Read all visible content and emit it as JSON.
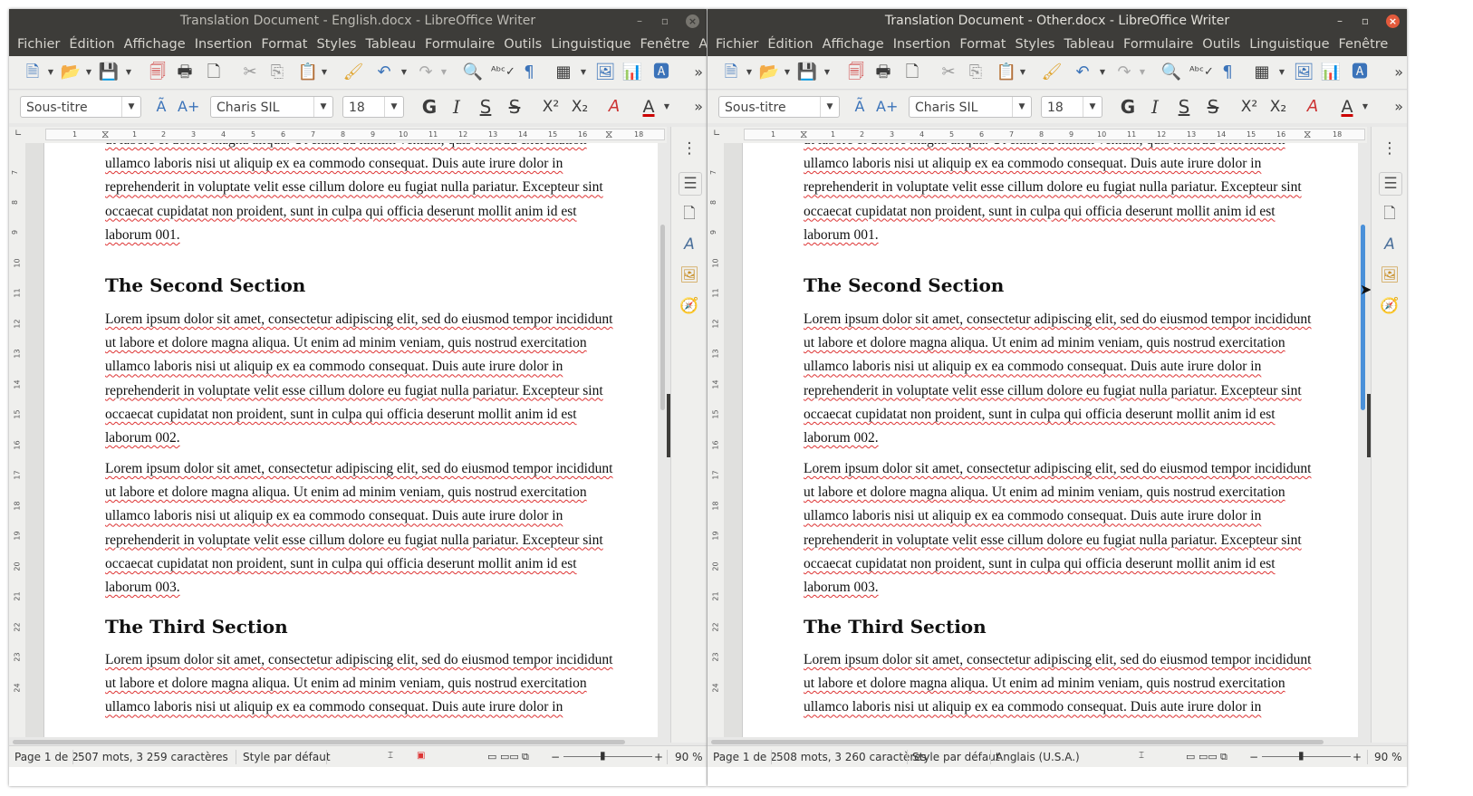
{
  "colors": {
    "titlebar": "#3d3c39",
    "accent": "#4a90d9",
    "spell_underline": "#dd3333",
    "font_color_red": "#cc0000"
  },
  "menu": [
    "Fichier",
    "Édition",
    "Affichage",
    "Insertion",
    "Format",
    "Styles",
    "Tableau",
    "Formulaire",
    "Outils",
    "Linguistique",
    "Fenêtre",
    "A"
  ],
  "toolbar": {
    "style_value": "Sous-titre",
    "font_value": "Charis SIL",
    "size_value": "18"
  },
  "ruler_ticks": [
    "1",
    "1",
    "2",
    "3",
    "4",
    "5",
    "6",
    "7",
    "8",
    "9",
    "10",
    "11",
    "12",
    "13",
    "14",
    "15",
    "16",
    "17",
    "18"
  ],
  "vruler_ticks": [
    "7",
    "8",
    "9",
    "10",
    "11",
    "12",
    "13",
    "14",
    "15",
    "16",
    "17",
    "18",
    "19",
    "20",
    "21",
    "22",
    "23",
    "24"
  ],
  "icons": [
    "new-document-icon",
    "open-folder-icon",
    "save-icon",
    "export-pdf-icon",
    "print-icon",
    "print-preview-icon",
    "cut-icon",
    "copy-icon",
    "paste-icon",
    "clone-formatting-icon",
    "undo-icon",
    "redo-icon",
    "find-replace-icon",
    "spellcheck-icon",
    "formatting-marks-icon",
    "insert-table-icon",
    "insert-image-icon",
    "insert-chart-icon",
    "insert-textbox-icon"
  ],
  "doc": {
    "p_top": [
      "ut labore et dolore magna aliqua. Ut enim ad minim veniam, quis nostrud exercitation",
      "ullamco laboris nisi ut aliquip ex ea commodo consequat. Duis aute irure dolor in",
      "reprehenderit in voluptate velit esse cillum dolore eu fugiat nulla pariatur. Excepteur sint",
      "occaecat cupidatat non proident, sunt in culpa qui officia deserunt mollit anim id est",
      "laborum 001."
    ],
    "h2": "The Second Section",
    "p2": [
      "Lorem ipsum dolor sit amet, consectetur adipiscing elit, sed do eiusmod tempor incididunt",
      "ut labore et dolore magna aliqua. Ut enim ad minim veniam, quis nostrud exercitation",
      "ullamco laboris nisi ut aliquip ex ea commodo consequat. Duis aute irure dolor in",
      "reprehenderit in voluptate velit esse cillum dolore eu fugiat nulla pariatur. Excepteur sint",
      "occaecat cupidatat non proident, sunt in culpa qui officia deserunt mollit anim id est",
      "laborum 002."
    ],
    "p3": [
      "Lorem ipsum dolor sit amet, consectetur adipiscing elit, sed do eiusmod tempor incididunt",
      "ut labore et dolore magna aliqua. Ut enim ad minim veniam, quis nostrud exercitation",
      "ullamco laboris nisi ut aliquip ex ea commodo consequat. Duis aute irure dolor in",
      "reprehenderit in voluptate velit esse cillum dolore eu fugiat nulla pariatur. Excepteur sint",
      "occaecat cupidatat non proident, sunt in culpa qui officia deserunt mollit anim id est",
      "laborum 003."
    ],
    "h3": "The Third Section",
    "p4": [
      "Lorem ipsum dolor sit amet, consectetur adipiscing elit, sed do eiusmod tempor incididunt",
      "ut labore et dolore magna aliqua. Ut enim ad minim veniam, quis nostrud exercitation",
      "ullamco laboris nisi ut aliquip ex ea commodo consequat. Duis aute irure dolor in"
    ]
  },
  "windows": [
    {
      "title": "Translation Document - English.docx - LibreOffice Writer",
      "status": {
        "page": "Page 1 de 2",
        "words": "507 mots, 3 259 caractères",
        "style": "Style par défaut",
        "language": "",
        "zoom": "90 %"
      }
    },
    {
      "title": "Translation Document - Other.docx - LibreOffice Writer",
      "status": {
        "page": "Page 1 de 2",
        "words": "508 mots, 3 260 caractères",
        "style": "Style par défaut",
        "language": "Anglais (U.S.A.)",
        "zoom": "90 %"
      }
    }
  ]
}
